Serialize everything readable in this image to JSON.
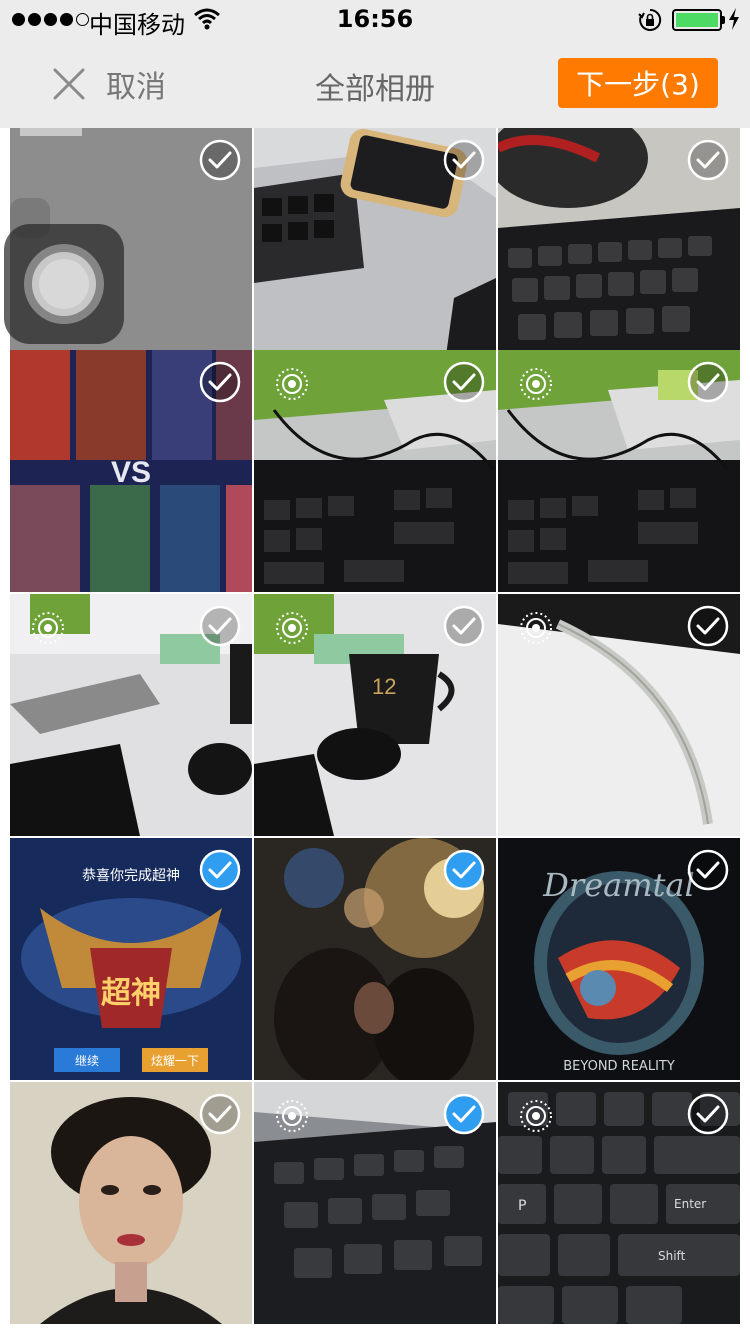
{
  "status_bar": {
    "carrier": "中国移动",
    "time": "16:56",
    "battery_level": 1.0,
    "icons": [
      "signal-icon",
      "wifi-icon",
      "orientation-lock-icon",
      "battery-icon",
      "charging-icon"
    ]
  },
  "nav": {
    "cancel_label": "取消",
    "title": "全部相册",
    "next_label": "下一步(3)"
  },
  "colors": {
    "accent": "#ff7a00",
    "selected": "#2f9ef0",
    "bar_bg": "#ececec"
  },
  "photos": [
    {
      "id": "camera",
      "selected": false,
      "live": false,
      "subject": "blank-gray"
    },
    {
      "id": "p2",
      "selected": false,
      "live": false,
      "subject": "phone-on-desk"
    },
    {
      "id": "p3",
      "selected": false,
      "live": false,
      "subject": "keyboard"
    },
    {
      "id": "p4",
      "selected": false,
      "live": false,
      "subject": "game-vs-screen"
    },
    {
      "id": "p5",
      "selected": false,
      "live": true,
      "subject": "keyboard-cables"
    },
    {
      "id": "p6",
      "selected": false,
      "live": true,
      "subject": "keyboard-cables"
    },
    {
      "id": "p7",
      "selected": false,
      "live": true,
      "subject": "desk-mouse"
    },
    {
      "id": "p8",
      "selected": false,
      "live": true,
      "subject": "mug-mouse"
    },
    {
      "id": "p9",
      "selected": false,
      "live": true,
      "subject": "white-cable"
    },
    {
      "id": "p10",
      "selected": true,
      "live": false,
      "subject": "game-victory"
    },
    {
      "id": "p11",
      "selected": true,
      "live": false,
      "subject": "night-crowd"
    },
    {
      "id": "p12",
      "selected": false,
      "live": false,
      "subject": "album-cover"
    },
    {
      "id": "p13",
      "selected": false,
      "live": false,
      "subject": "portrait"
    },
    {
      "id": "p14",
      "selected": true,
      "live": true,
      "subject": "blurry-keyboard"
    },
    {
      "id": "p15",
      "selected": false,
      "live": true,
      "subject": "keyboard-closeup"
    }
  ]
}
